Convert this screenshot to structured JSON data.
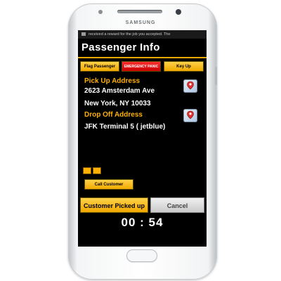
{
  "device": {
    "brand": "SAMSUNG"
  },
  "notification": {
    "text": "received a reward for the job you accepted. The"
  },
  "header": {
    "title": "Passenger Info"
  },
  "actions": {
    "flag_label": "Flag Passenger",
    "panic_label": "EMERGENCY PANIC",
    "keyup_label": "Key Up"
  },
  "pickup": {
    "label": "Pick Up Address",
    "line1": "2623 Amsterdam Ave",
    "line2": "New York, NY 10033"
  },
  "dropoff": {
    "label": "Drop Off Address",
    "line1": "JFK Terminal 5 ( jetblue)"
  },
  "call_label": "Call Customer",
  "picked_up_label": "Customer Picked up",
  "cancel_label": "Cancel",
  "timer": "00 : 54",
  "colors": {
    "accent_orange": "#ffb000",
    "button_yellow": "#f0a800",
    "panic_red": "#d00000",
    "screen_bg": "#000000"
  }
}
